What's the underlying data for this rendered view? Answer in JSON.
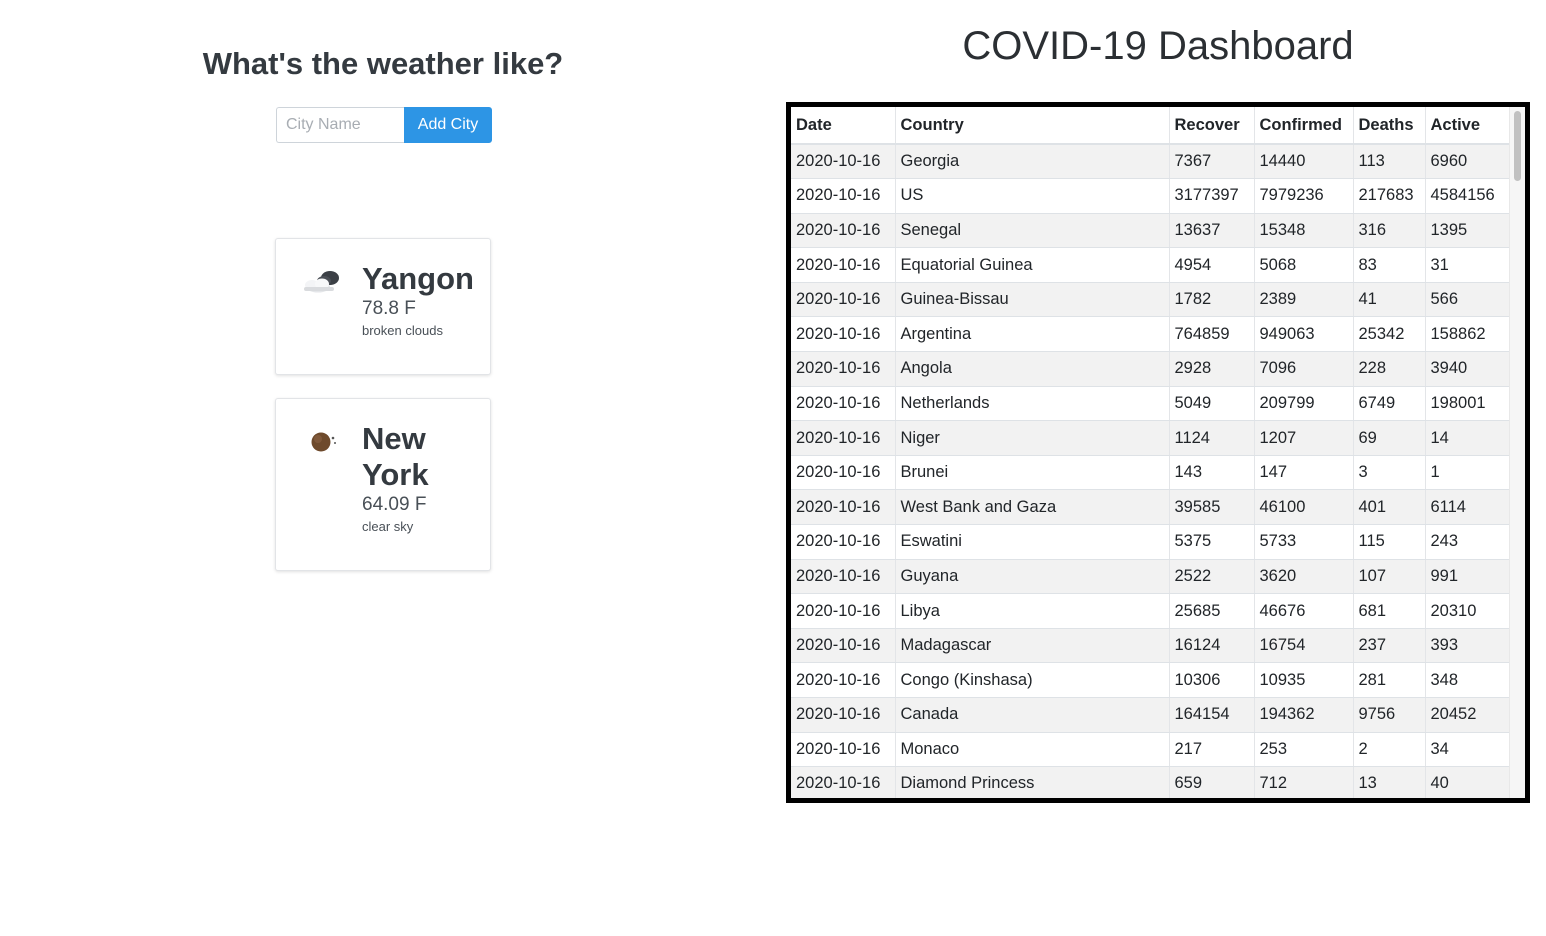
{
  "weather": {
    "title": "What's the weather like?",
    "city_input_placeholder": "City Name",
    "add_button_label": "Add City",
    "cards": [
      {
        "city": "Yangon",
        "temp": "78.8 F",
        "desc": "broken clouds",
        "icon": "broken-clouds-icon"
      },
      {
        "city": "New York",
        "temp": "64.09 F",
        "desc": "clear sky",
        "icon": "clear-sky-night-icon"
      }
    ]
  },
  "covid": {
    "title": "COVID-19 Dashboard",
    "columns": [
      "Date",
      "Country",
      "Recover",
      "Confirmed",
      "Deaths",
      "Active"
    ],
    "rows": [
      [
        "2020-10-16",
        "Georgia",
        "7367",
        "14440",
        "113",
        "6960"
      ],
      [
        "2020-10-16",
        "US",
        "3177397",
        "7979236",
        "217683",
        "4584156"
      ],
      [
        "2020-10-16",
        "Senegal",
        "13637",
        "15348",
        "316",
        "1395"
      ],
      [
        "2020-10-16",
        "Equatorial Guinea",
        "4954",
        "5068",
        "83",
        "31"
      ],
      [
        "2020-10-16",
        "Guinea-Bissau",
        "1782",
        "2389",
        "41",
        "566"
      ],
      [
        "2020-10-16",
        "Argentina",
        "764859",
        "949063",
        "25342",
        "158862"
      ],
      [
        "2020-10-16",
        "Angola",
        "2928",
        "7096",
        "228",
        "3940"
      ],
      [
        "2020-10-16",
        "Netherlands",
        "5049",
        "209799",
        "6749",
        "198001"
      ],
      [
        "2020-10-16",
        "Niger",
        "1124",
        "1207",
        "69",
        "14"
      ],
      [
        "2020-10-16",
        "Brunei",
        "143",
        "147",
        "3",
        "1"
      ],
      [
        "2020-10-16",
        "West Bank and Gaza",
        "39585",
        "46100",
        "401",
        "6114"
      ],
      [
        "2020-10-16",
        "Eswatini",
        "5375",
        "5733",
        "115",
        "243"
      ],
      [
        "2020-10-16",
        "Guyana",
        "2522",
        "3620",
        "107",
        "991"
      ],
      [
        "2020-10-16",
        "Libya",
        "25685",
        "46676",
        "681",
        "20310"
      ],
      [
        "2020-10-16",
        "Madagascar",
        "16124",
        "16754",
        "237",
        "393"
      ],
      [
        "2020-10-16",
        "Congo (Kinshasa)",
        "10306",
        "10935",
        "281",
        "348"
      ],
      [
        "2020-10-16",
        "Canada",
        "164154",
        "194362",
        "9756",
        "20452"
      ],
      [
        "2020-10-16",
        "Monaco",
        "217",
        "253",
        "2",
        "34"
      ],
      [
        "2020-10-16",
        "Diamond Princess",
        "659",
        "712",
        "13",
        "40"
      ]
    ]
  }
}
